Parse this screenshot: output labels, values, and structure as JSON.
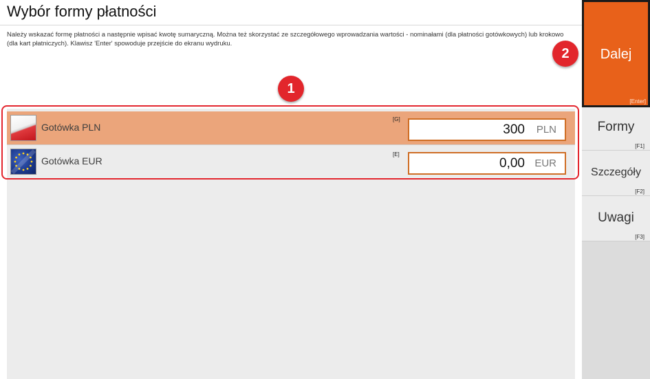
{
  "header": {
    "title": "Wybór formy płatności",
    "description": "Należy wskazać formę płatności a następnie wpisać kwotę sumaryczną. Można też skorzystać ze szczegółowego wprowadzania wartości - nominałami (dla płatności gotówkowych) lub krokowo (dla kart płatniczych). Klawisz 'Enter' spowoduje przejście do ekranu wydruku."
  },
  "payments": [
    {
      "label": "Gotówka PLN",
      "hotkey": "[G]",
      "amount": "300",
      "currency": "PLN",
      "flag": "poland-flag-icon",
      "selected": true
    },
    {
      "label": "Gotówka EUR",
      "hotkey": "[E]",
      "amount": "0,00",
      "currency": "EUR",
      "flag": "eu-flag-icon",
      "selected": false
    }
  ],
  "badges": {
    "one": "1",
    "two": "2"
  },
  "sidebar": {
    "next": {
      "label": "Dalej",
      "key": "[Enter]"
    },
    "buttons": [
      {
        "label": "Formy",
        "key": "[F1]"
      },
      {
        "label": "Szczegóły",
        "key": "[F2]"
      },
      {
        "label": "Uwagi",
        "key": "[F3]"
      }
    ]
  },
  "colors": {
    "accent": "#e8611a",
    "selected_row": "#eba57b",
    "highlight_frame": "#e3262e",
    "input_border": "#cf6d24"
  }
}
